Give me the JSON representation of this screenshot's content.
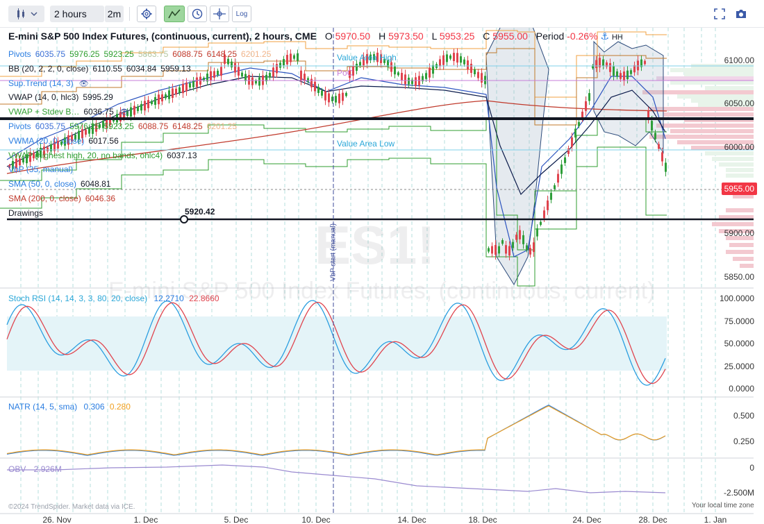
{
  "toolbar": {
    "chart_type_icon": "candlestick-icon",
    "interval": "2 hours",
    "compare_interval": "2m",
    "log_label": "Log",
    "accent": "#9ed69e"
  },
  "symbol": {
    "title": "E-mini S&P 500 Index Futures, (continuous, current), 2 hours, CME",
    "o_label": "O",
    "o_value": "5970.50",
    "h_label": "H",
    "h_value": "5973.50",
    "l_label": "L",
    "l_value": "5953.25",
    "c_label": "C",
    "c_value": "5955.00",
    "period_label": "Period",
    "period_value": "-0.26%",
    "hh_label": "HH",
    "watermark_ticker": "ES1!",
    "watermark_name": "E-mini S&P 500 Index Futures, (continuous, current)"
  },
  "indicators": [
    {
      "name": "Pivots",
      "values": [
        "6035.75",
        "5976.25",
        "5923.25",
        "5863.75",
        "6088.75",
        "6148.25",
        "6201.25"
      ],
      "colors": [
        "#3b6fd6",
        "#2f9e2f",
        "#2f9e2f",
        "#b4c7a0",
        "#c0392b",
        "#c0392b",
        "#f0b48a"
      ]
    },
    {
      "name": "BB (20, 2, 2, 0, close)",
      "values": [
        "6110.55",
        "6034.84",
        "5959.13"
      ],
      "colors": [
        "#131722",
        "#131722",
        "#131722"
      ]
    },
    {
      "name": "Sup.Trend (14, 3)",
      "values": [],
      "colors": []
    },
    {
      "name": "VWAP (14, 0, hlc3)",
      "values": [
        "5995.29"
      ],
      "colors": [
        "#131722"
      ]
    },
    {
      "name": "VWAP + Stdev B…",
      "values": [
        "6036.75"
      ],
      "colors": [
        "#131722"
      ]
    },
    {
      "name": "Pivots",
      "values": [
        "6035.75",
        "5976.25",
        "5923.25",
        "6088.75",
        "6148.25",
        "6201.25"
      ],
      "colors": [
        "#3b6fd6",
        "#2f9e2f",
        "#2f9e2f",
        "#c0392b",
        "#c0392b",
        "#f0b48a"
      ]
    },
    {
      "name": "VWMA (20, 0, close)",
      "values": [
        "6017.56"
      ],
      "colors": [
        "#131722"
      ]
    },
    {
      "name": "VWAP (highest high, 20, no bands, ohlc4)",
      "values": [
        "6037.13"
      ],
      "colors": [
        "#131722"
      ]
    },
    {
      "name": "VbP (35, manual)",
      "values": [],
      "colors": []
    },
    {
      "name": "SMA (50, 0, close)",
      "values": [
        "6048.81"
      ],
      "colors": [
        "#131722"
      ]
    },
    {
      "name": "SMA (200, 0, close)",
      "values": [
        "6046.36"
      ],
      "colors": [
        "#c0392b"
      ]
    },
    {
      "name": "Drawings",
      "values": [],
      "colors": []
    }
  ],
  "indicator_name_colors": [
    "#2a7de1",
    "#131722",
    "#2a7de1",
    "#131722",
    "#2f9e2f",
    "#2a7de1",
    "#2a7de1",
    "#2f9e2f",
    "#2a7de1",
    "#2a7de1",
    "#c0392b",
    "#131722"
  ],
  "levels": {
    "value_area_high": "Value Area High",
    "poc": "PoC",
    "value_area_low": "Value Area Low",
    "hline_label": "5920.42",
    "vbp_start": "VbP start (manual)"
  },
  "price_axis": {
    "ticks": [
      "6100.00",
      "6050.00",
      "6000.00",
      "5900.00",
      "5850.00"
    ],
    "current_price": "5955.00",
    "current_color": "#f23645"
  },
  "stoch_rsi": {
    "name": "Stoch RSI (14, 14, 3, 3, 80, 20, close)",
    "k_value": "12.2710",
    "d_value": "22.8660",
    "ticks": [
      "100.0000",
      "75.0000",
      "50.0000",
      "25.0000",
      "0.0000"
    ]
  },
  "natr": {
    "name": "NATR (14, 5, sma)",
    "value1": "0.306",
    "value2": "0.280",
    "ticks": [
      "0.500",
      "0.250"
    ]
  },
  "obv": {
    "name": "OBV",
    "value": "-2.926M",
    "ticks": [
      "0",
      "-2.500M"
    ]
  },
  "date_axis": {
    "labels": [
      "26. Nov",
      "1. Dec",
      "5. Dec",
      "10. Dec",
      "14. Dec",
      "18. Dec",
      "24. Dec",
      "28. Dec",
      "1. Jan"
    ]
  },
  "footer": {
    "copyright": "©2024 TrendSpider. Market data via ICE.",
    "timezone": "Your local time zone"
  }
}
